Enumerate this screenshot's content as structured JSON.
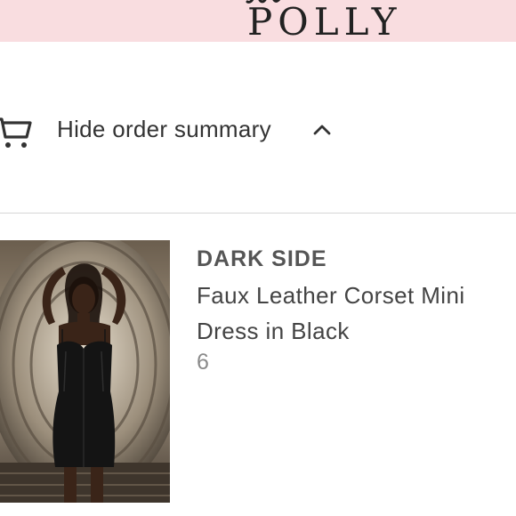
{
  "header": {
    "logo_text": "POLLY",
    "background_color": "#f9dde0"
  },
  "order_summary": {
    "toggle_label": "Hide order summary",
    "cart_icon": "cart-icon",
    "chevron_icon": "chevron-up-icon"
  },
  "product": {
    "brand": "DARK SIDE",
    "title": "Faux Leather Corset Mini Dress in Black",
    "variant": "6"
  }
}
